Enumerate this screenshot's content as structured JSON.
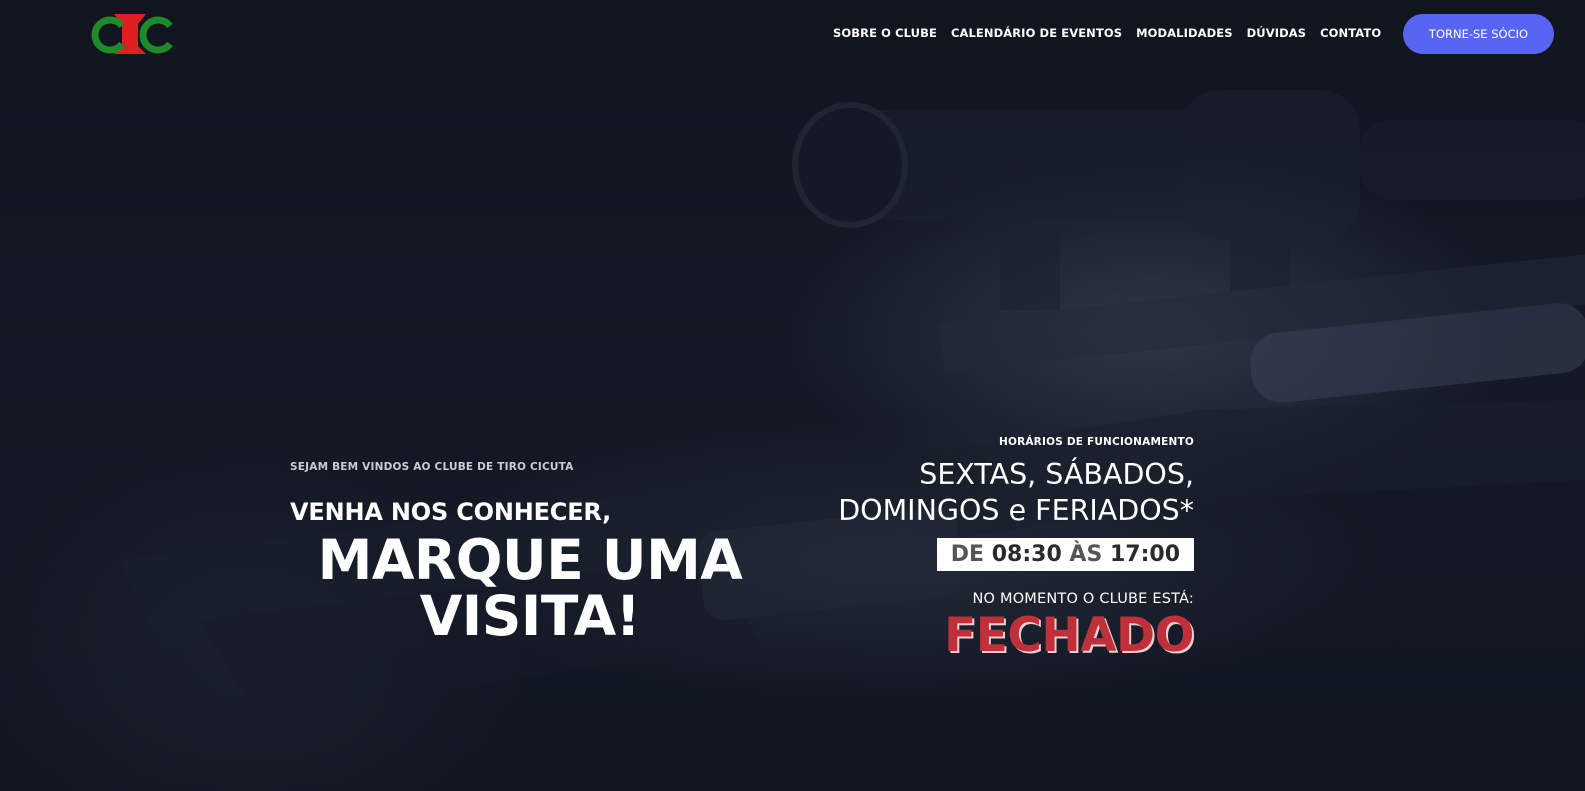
{
  "header": {
    "nav": [
      {
        "label": "SOBRE O CLUBE"
      },
      {
        "label": "CALENDÁRIO DE EVENTOS"
      },
      {
        "label": "MODALIDADES"
      },
      {
        "label": "DÚVIDAS"
      },
      {
        "label": "CONTATO"
      }
    ],
    "cta_label": "TORNE-SE SÓCIO"
  },
  "hero": {
    "welcome": "SEJAM BEM VINDOS AO CLUBE DE TIRO CICUTA",
    "line1": "VENHA NOS CONHECER,",
    "line2": "MARQUE UMA",
    "line3": "VISITA!"
  },
  "schedule": {
    "label": "HORÁRIOS DE FUNCIONAMENTO",
    "days_line1": "SEXTAS, SÁBADOS,",
    "days_line2": "DOMINGOS e FERIADOS*",
    "hours_prefix": "DE",
    "open_time": "08:30",
    "hours_sep": "ÀS",
    "close_time": "17:00",
    "status_label": "NO MOMENTO O CLUBE ESTÁ:",
    "status": "FECHADO"
  },
  "colors": {
    "accent": "#5865f2",
    "status_closed": "#c0303a",
    "logo_green": "#1f8a2a",
    "logo_red": "#e02020"
  }
}
